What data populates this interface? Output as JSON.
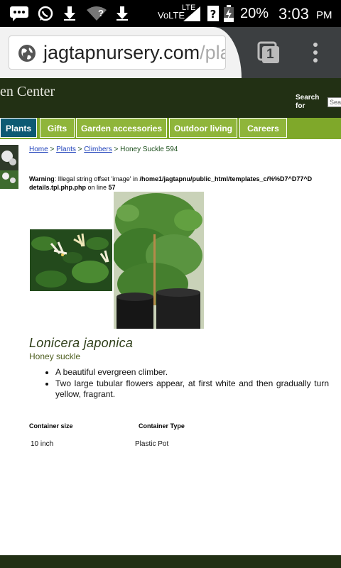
{
  "status_bar": {
    "network": "VoLTE",
    "lte": "LTE",
    "battery": "20%",
    "time": "3:03",
    "ampm": "PM",
    "wifi_question": "?"
  },
  "browser": {
    "url_main": "jagtapnursery.com",
    "url_rest": "/pla",
    "tab_count": "1"
  },
  "site": {
    "brand": "en Center",
    "search_label_1": "Search",
    "search_label_2": "for",
    "search_placeholder": "Sear"
  },
  "nav": {
    "items": [
      {
        "label": "Plants"
      },
      {
        "label": "Gifts"
      },
      {
        "label": "Garden accessories"
      },
      {
        "label": "Outdoor living"
      },
      {
        "label": "Careers"
      }
    ]
  },
  "breadcrumb": {
    "home": "Home",
    "sep": " > ",
    "plants": "Plants",
    "climbers": "Climbers",
    "current": "Honey Suckle 594"
  },
  "warning": {
    "label": "Warning",
    "message": ": Illegal string offset 'image' in ",
    "path": "/home1/jagtapnu/public_html/templates_c/%%D7^D77^D",
    "file": "details.tpl.php.php",
    "on_line": " on line ",
    "line": "57"
  },
  "product": {
    "latin_name": "Lonicera japonica",
    "common_name": "Honey suckle",
    "features": [
      "A beautiful evergreen climber.",
      "Two large tubular flowers appear, at first white and then gradually turn yellow, fragrant."
    ],
    "specs": {
      "size_header": "Container size",
      "type_header": "Container Type",
      "size_value": "10 inch",
      "type_value": "Plastic Pot"
    }
  },
  "colors": {
    "header_bg": "#223014",
    "nav_green": "#8fb53a",
    "nav_active": "#0d5a73"
  }
}
